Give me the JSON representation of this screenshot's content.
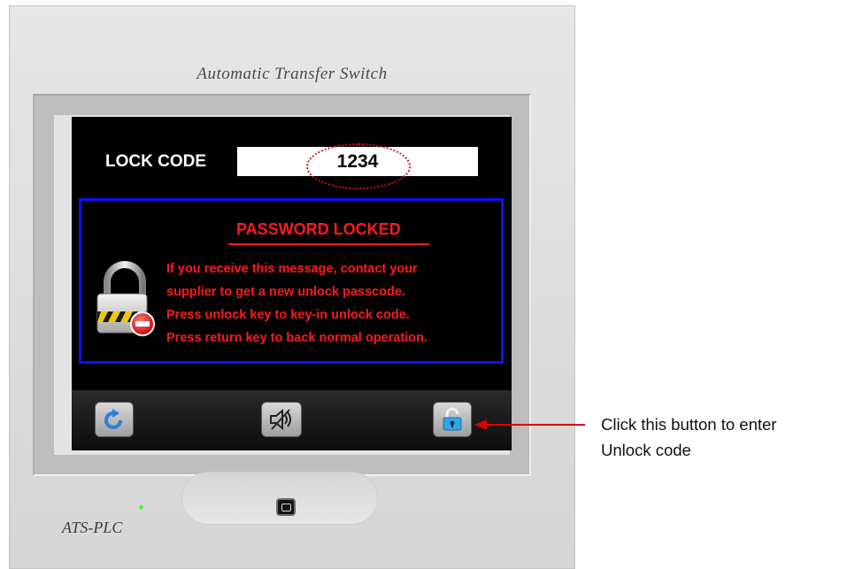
{
  "device": {
    "title": "Automatic  Transfer  Switch",
    "brand": "ATS-PLC"
  },
  "screen": {
    "lock_code_label": "LOCK CODE",
    "lock_code_value": "1234",
    "message": {
      "title": "PASSWORD LOCKED",
      "lines": [
        "If you receive this message, contact your",
        "supplier to get a new unlock passcode.",
        "Press unlock key to key-in unlock code.",
        "Press return key to back normal operation."
      ]
    },
    "toolbar": {
      "buttons": [
        {
          "icon": "return-icon"
        },
        {
          "icon": "mute-icon"
        },
        {
          "icon": "unlock-icon"
        }
      ]
    }
  },
  "annotation": {
    "line1": "Click this button to enter",
    "line2": "Unlock code",
    "color": "#e00000"
  },
  "colors": {
    "screen_bg": "#000000",
    "alert_red": "#ff1a1a",
    "message_border": "#1010ff",
    "status_led": "#3cff3c"
  }
}
